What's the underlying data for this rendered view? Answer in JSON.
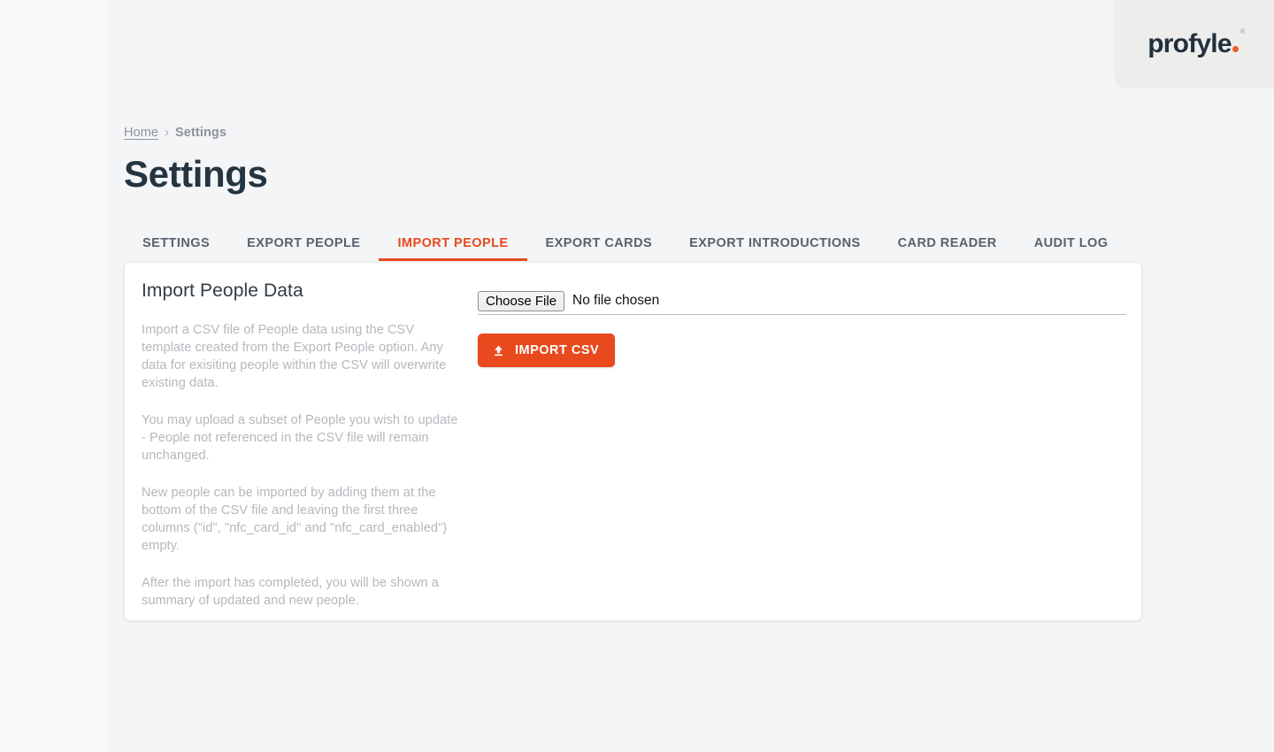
{
  "brand": {
    "name": "profyle",
    "dot": ".",
    "registered": "®",
    "text_color": "#22303c",
    "dot_color": "#ef5a29"
  },
  "breadcrumb": {
    "home_label": "Home",
    "separator": "›",
    "current_label": "Settings"
  },
  "header": {
    "title": "Settings"
  },
  "tabs": [
    {
      "label": "SETTINGS",
      "active": false
    },
    {
      "label": "EXPORT PEOPLE",
      "active": false
    },
    {
      "label": "IMPORT PEOPLE",
      "active": true
    },
    {
      "label": "EXPORT CARDS",
      "active": false
    },
    {
      "label": "EXPORT INTRODUCTIONS",
      "active": false
    },
    {
      "label": "CARD READER",
      "active": false
    },
    {
      "label": "AUDIT LOG",
      "active": false
    }
  ],
  "card": {
    "heading": "Import People Data",
    "paragraphs": [
      "Import a CSV file of People data using the CSV template created from the Export People option. Any data for exisiting people within the CSV will overwrite existing data.",
      "You may upload a subset of People you wish to update - People not referenced in the CSV file will remain unchanged.",
      "New people can be imported by adding them at the bottom of the CSV file and leaving the first three columns (\"id\", \"nfc_card_id\" and \"nfc_card_enabled\") empty.",
      "After the import has completed, you will be shown a summary of updated and new people."
    ]
  },
  "form": {
    "file_input": {
      "button_label": "Choose File",
      "file_status": "No file chosen"
    },
    "submit": {
      "label": "IMPORT CSV",
      "icon": "upload-icon",
      "color": "#e8491d"
    }
  },
  "theme": {
    "page_background": "#f4f5f7",
    "card_background": "#ffffff",
    "accent": "#e8491d",
    "title_color": "#243441",
    "muted_text": "#b4b8bd"
  }
}
